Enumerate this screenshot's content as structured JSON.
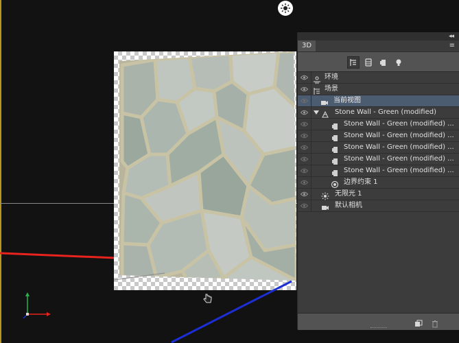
{
  "panel": {
    "tab_label": "3D",
    "collapse_glyph": "◂◂",
    "menu_glyph": "≡",
    "filters": [
      {
        "icon": "whole-scene-filter-icon",
        "active": true
      },
      {
        "icon": "meshes-filter-icon",
        "active": false
      },
      {
        "icon": "materials-filter-icon",
        "active": false
      },
      {
        "icon": "lights-filter-icon",
        "active": false
      }
    ],
    "layers": [
      {
        "label": "环境",
        "icon": "environment-icon",
        "eye": true,
        "indent": 0
      },
      {
        "label": "场景",
        "icon": "scene-icon",
        "eye": true,
        "indent": 0
      },
      {
        "label": "当前视图",
        "icon": "camera-icon",
        "eye": false,
        "indent": 1,
        "selected": true
      },
      {
        "label": "Stone Wall - Green (modified)",
        "icon": "mesh-icon",
        "eye": true,
        "indent": 1,
        "expanded": true
      },
      {
        "label": "Stone Wall - Green (modified) ...",
        "icon": "material-icon",
        "eye": false,
        "indent": 2
      },
      {
        "label": "Stone Wall - Green (modified) ...",
        "icon": "material-icon",
        "eye": false,
        "indent": 2
      },
      {
        "label": "Stone Wall - Green (modified) ...",
        "icon": "material-icon",
        "eye": false,
        "indent": 2
      },
      {
        "label": "Stone Wall - Green (modified) ...",
        "icon": "material-icon",
        "eye": false,
        "indent": 2
      },
      {
        "label": "Stone Wall - Green (modified) ...",
        "icon": "material-icon",
        "eye": false,
        "indent": 2
      },
      {
        "label": "边界约束 1",
        "icon": "constraint-icon",
        "eye": false,
        "indent": 2
      },
      {
        "label": "无限光 1",
        "icon": "infinite-light-icon",
        "eye": true,
        "indent": 1
      },
      {
        "label": "默认相机",
        "icon": "camera-icon",
        "eye": false,
        "indent": 1
      }
    ],
    "bottom_buttons": [
      "add-new-object-icon",
      "delete-icon"
    ]
  },
  "viewport": {
    "colors": {
      "x_axis": "#e8231d",
      "z_axis": "#1c2fd6",
      "y_axis": "#27b34a",
      "highlight_edge": "#b8961c"
    }
  }
}
